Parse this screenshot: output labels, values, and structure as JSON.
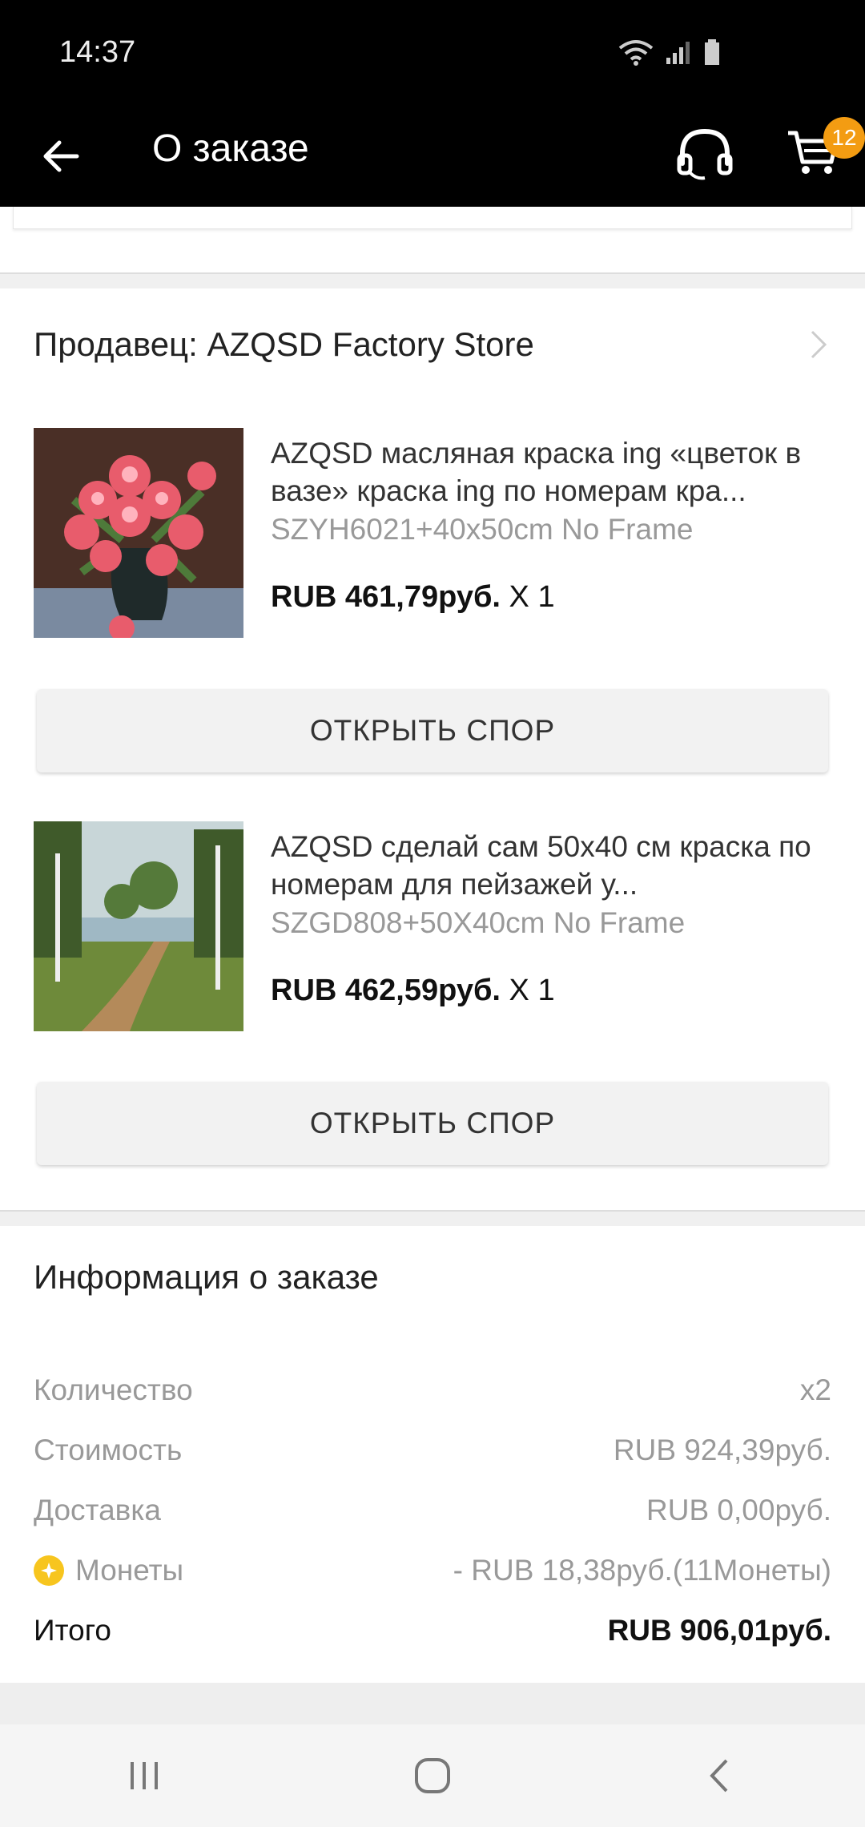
{
  "status_bar": {
    "time": "14:37"
  },
  "app_bar": {
    "title": "О заказе",
    "cart_count": "12"
  },
  "seller": {
    "label": "Продавец: AZQSD Factory Store"
  },
  "products": [
    {
      "title": "AZQSD масляная краска ing «цветок в вазе» краска ing по номерам кра...",
      "sku": "SZYH6021+40x50cm No Frame",
      "price": "RUB 461,79руб.",
      "qty": " X 1",
      "dispute_label": "ОТКРЫТЬ СПОР"
    },
    {
      "title": "AZQSD сделай сам 50x40 см краска по номерам для пейзажей у...",
      "sku": "SZGD808+50X40cm No Frame",
      "price": "RUB 462,59руб.",
      "qty": " X 1",
      "dispute_label": "ОТКРЫТЬ СПОР"
    }
  ],
  "order_info": {
    "title": "Информация о заказе",
    "rows": [
      {
        "label": "Количество",
        "value": "x2"
      },
      {
        "label": "Стоимость",
        "value": "RUB 924,39руб."
      },
      {
        "label": "Доставка",
        "value": "RUB 0,00руб."
      },
      {
        "label": "Монеты",
        "value": "- RUB 18,38руб.(11Монеты)"
      },
      {
        "label": "Итого",
        "value": "RUB 906,01руб."
      }
    ]
  },
  "colors": {
    "badge": "#f39c12",
    "coin": "#f7c51e",
    "appbar": "#000000"
  }
}
